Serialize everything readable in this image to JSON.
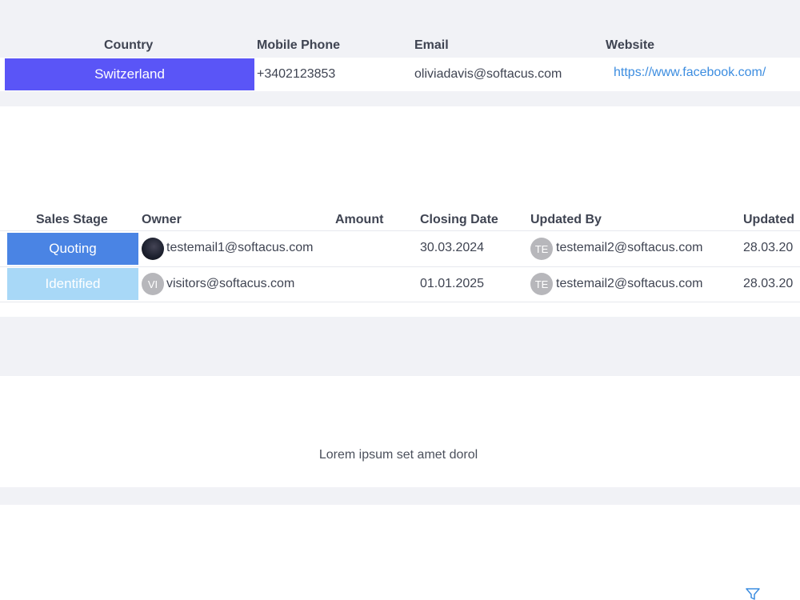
{
  "contact_table": {
    "headers": {
      "country": "Country",
      "mobile": "Mobile Phone",
      "email": "Email",
      "website": "Website"
    },
    "row": {
      "country": "Switzerland",
      "mobile": "+3402123853",
      "email": "oliviadavis@softacus.com",
      "website": "https://www.facebook.com/"
    },
    "country_badge_color": "#5a55f7"
  },
  "deals_table": {
    "headers": {
      "stage": "Sales Stage",
      "owner": "Owner",
      "amount": "Amount",
      "closing": "Closing Date",
      "updated_by": "Updated By",
      "updated": "Updated"
    },
    "rows": [
      {
        "stage": "Quoting",
        "stage_color": "#4a84e4",
        "owner_avatar": "",
        "owner": "testemail1@softacus.com",
        "amount": "",
        "closing": "30.03.2024",
        "updated_by_avatar": "TE",
        "updated_by": "testemail2@softacus.com",
        "updated": "28.03.20"
      },
      {
        "stage": "Identified",
        "stage_color": "#a8d8f7",
        "owner_avatar": "VI",
        "owner": "visitors@softacus.com",
        "amount": "",
        "closing": "01.01.2025",
        "updated_by_avatar": "TE",
        "updated_by": "testemail2@softacus.com",
        "updated": "28.03.20"
      }
    ]
  },
  "text_block": {
    "body": "Lorem ipsum set amet dorol"
  },
  "icons": {
    "filter": "filter-icon"
  }
}
